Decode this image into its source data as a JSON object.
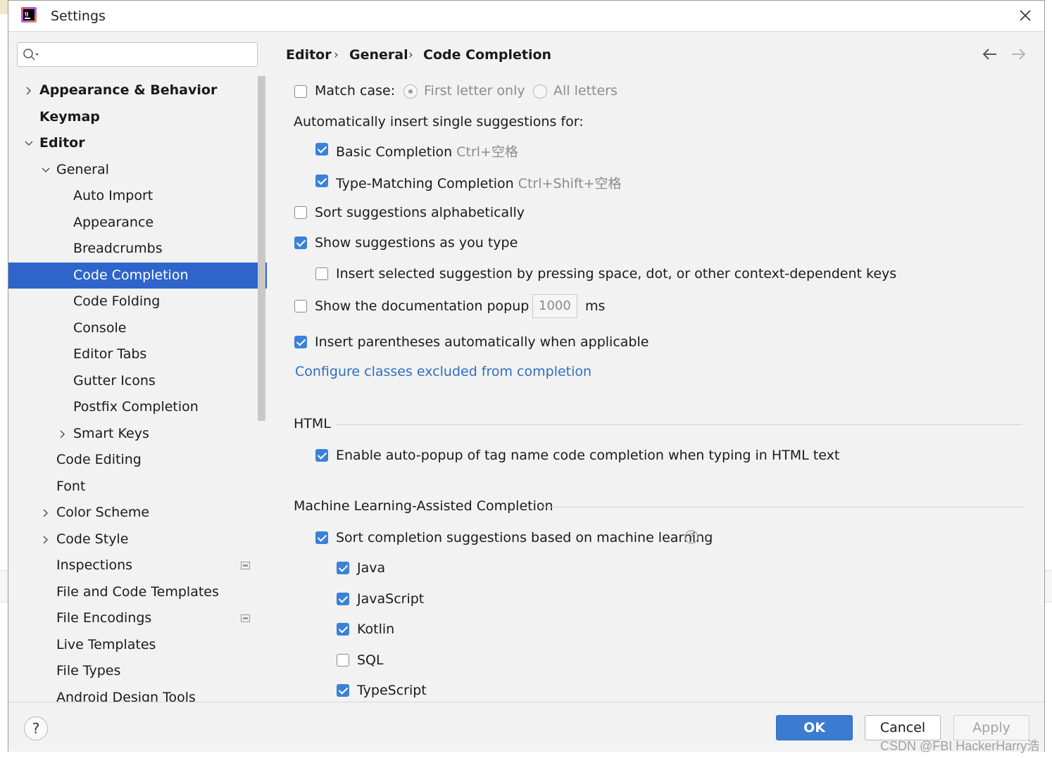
{
  "window": {
    "title": "Settings"
  },
  "search": {
    "placeholder": "",
    "value": ""
  },
  "tree": [
    {
      "label": "Appearance & Behavior",
      "level": 0,
      "bold": true,
      "expander": "collapsed"
    },
    {
      "label": "Keymap",
      "level": 0,
      "bold": true,
      "expander": "none"
    },
    {
      "label": "Editor",
      "level": 0,
      "bold": true,
      "expander": "expanded"
    },
    {
      "label": "General",
      "level": 1,
      "bold": false,
      "expander": "expanded"
    },
    {
      "label": "Auto Import",
      "level": 2,
      "bold": false,
      "expander": "none"
    },
    {
      "label": "Appearance",
      "level": 2,
      "bold": false,
      "expander": "none"
    },
    {
      "label": "Breadcrumbs",
      "level": 2,
      "bold": false,
      "expander": "none"
    },
    {
      "label": "Code Completion",
      "level": 2,
      "bold": false,
      "expander": "none",
      "selected": true
    },
    {
      "label": "Code Folding",
      "level": 2,
      "bold": false,
      "expander": "none"
    },
    {
      "label": "Console",
      "level": 2,
      "bold": false,
      "expander": "none"
    },
    {
      "label": "Editor Tabs",
      "level": 2,
      "bold": false,
      "expander": "none"
    },
    {
      "label": "Gutter Icons",
      "level": 2,
      "bold": false,
      "expander": "none"
    },
    {
      "label": "Postfix Completion",
      "level": 2,
      "bold": false,
      "expander": "none"
    },
    {
      "label": "Smart Keys",
      "level": 2,
      "bold": false,
      "expander": "collapsed"
    },
    {
      "label": "Code Editing",
      "level": 1,
      "bold": false,
      "expander": "none"
    },
    {
      "label": "Font",
      "level": 1,
      "bold": false,
      "expander": "none"
    },
    {
      "label": "Color Scheme",
      "level": 1,
      "bold": false,
      "expander": "collapsed"
    },
    {
      "label": "Code Style",
      "level": 1,
      "bold": false,
      "expander": "collapsed"
    },
    {
      "label": "Inspections",
      "level": 1,
      "bold": false,
      "expander": "none",
      "project_icon": true
    },
    {
      "label": "File and Code Templates",
      "level": 1,
      "bold": false,
      "expander": "none"
    },
    {
      "label": "File Encodings",
      "level": 1,
      "bold": false,
      "expander": "none",
      "project_icon": true
    },
    {
      "label": "Live Templates",
      "level": 1,
      "bold": false,
      "expander": "none"
    },
    {
      "label": "File Types",
      "level": 1,
      "bold": false,
      "expander": "none"
    },
    {
      "label": "Android Design Tools",
      "level": 1,
      "bold": false,
      "expander": "none"
    }
  ],
  "breadcrumb": {
    "items": [
      "Editor",
      "General",
      "Code Completion"
    ],
    "separator": "›"
  },
  "nav": {
    "back_icon": "arrow-left-icon",
    "forward_icon": "arrow-right-icon"
  },
  "settings": {
    "match_case": {
      "label": "Match case:",
      "checked": false
    },
    "first_letter_only": {
      "label": "First letter only",
      "selected": true,
      "enabled": false
    },
    "all_letters": {
      "label": "All letters",
      "selected": false,
      "enabled": false
    },
    "auto_insert_heading": "Automatically insert single suggestions for:",
    "basic_completion": {
      "label": "Basic Completion",
      "shortcut": "Ctrl+空格",
      "checked": true
    },
    "type_matching": {
      "label": "Type-Matching Completion",
      "shortcut": "Ctrl+Shift+空格",
      "checked": true
    },
    "sort_alpha": {
      "label": "Sort suggestions alphabetically",
      "checked": false
    },
    "show_as_type": {
      "label": "Show suggestions as you type",
      "checked": true
    },
    "insert_selected": {
      "label": "Insert selected suggestion by pressing space, dot, or other context-dependent keys",
      "checked": false
    },
    "doc_popup": {
      "label": "Show the documentation popup in",
      "value": "1000",
      "unit": "ms",
      "checked": false
    },
    "insert_parens": {
      "label": "Insert parentheses automatically when applicable",
      "checked": true
    },
    "configure_link": "Configure classes excluded from completion",
    "html_section": "HTML",
    "html_auto_popup": {
      "label": "Enable auto-popup of tag name code completion when typing in HTML text",
      "checked": true
    },
    "ml_section": "Machine Learning-Assisted Completion",
    "ml_sort": {
      "label": "Sort completion suggestions based on machine learning",
      "checked": true
    },
    "ml_languages": [
      {
        "label": "Java",
        "checked": true
      },
      {
        "label": "JavaScript",
        "checked": true
      },
      {
        "label": "Kotlin",
        "checked": true
      },
      {
        "label": "SQL",
        "checked": false
      },
      {
        "label": "TypeScript",
        "checked": true
      }
    ]
  },
  "footer": {
    "help_label": "?",
    "ok_label": "OK",
    "cancel_label": "Cancel",
    "apply_label": "Apply"
  },
  "watermark": "CSDN @FBI HackerHarry浩",
  "colors": {
    "selection": "#2f65ca",
    "accent": "#3a82d8",
    "link": "#2e6fc0"
  }
}
